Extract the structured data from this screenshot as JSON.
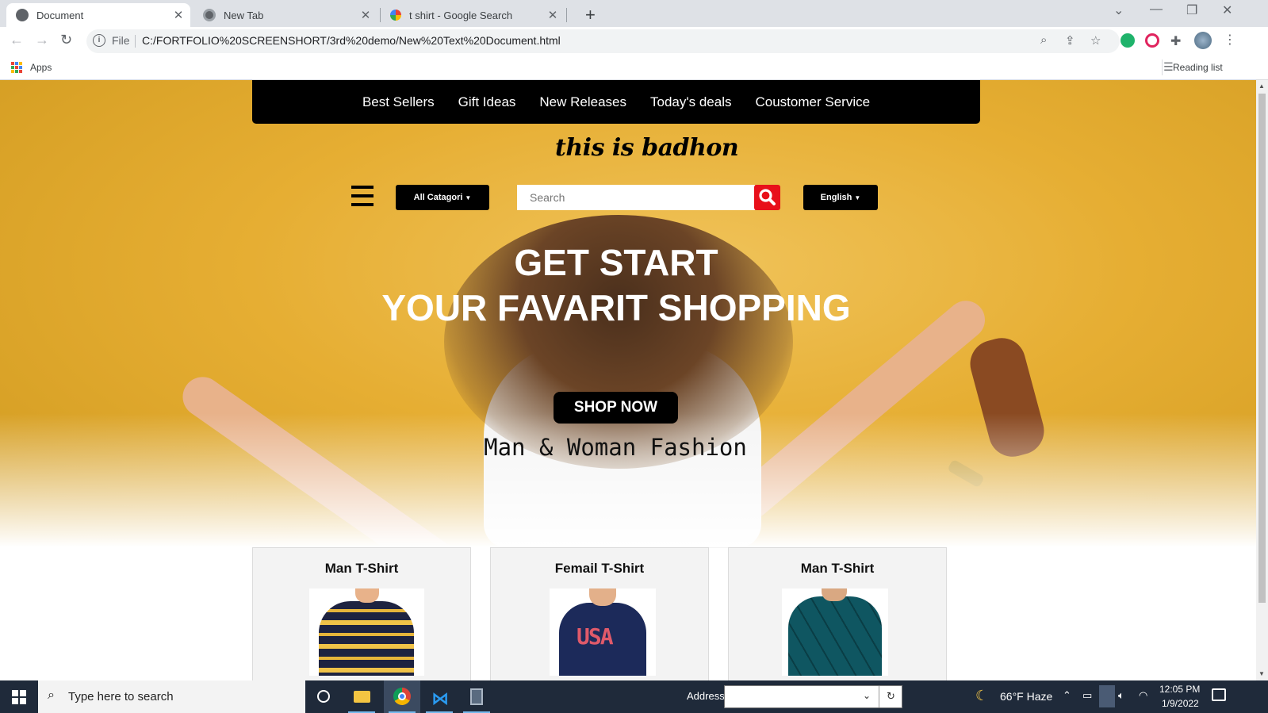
{
  "browser": {
    "tabs": [
      {
        "title": "Document",
        "active": true
      },
      {
        "title": "New Tab",
        "active": false
      },
      {
        "title": "t shirt - Google Search",
        "active": false
      }
    ],
    "new_tab_symbol": "+",
    "close_symbol": "✕",
    "omnibox": {
      "scheme_label": "File",
      "url": "C:/FORTFOLIO%20SCREENSHORT/3rd%20demo/New%20Text%20Document.html"
    },
    "bookmarks": {
      "apps_label": "Apps",
      "reading_list_label": "Reading list"
    }
  },
  "page": {
    "nav_links": [
      "Best Sellers",
      "Gift Ideas",
      "New Releases",
      "Today's deals",
      "Coustomer Service"
    ],
    "brand": "this is badhon",
    "category_dropdown": "All Catagori",
    "search_placeholder": "Search",
    "language_dropdown": "English",
    "headline_line1": "GET START",
    "headline_line2": "YOUR FAVARIT SHOPPING",
    "shop_button": "SHOP NOW",
    "tagline": "Man & Woman Fashion",
    "cards": [
      {
        "title": "Man T-Shirt"
      },
      {
        "title": "Femail T-Shirt"
      },
      {
        "title": "Man T-Shirt"
      }
    ],
    "accent_color": "#e8101a"
  },
  "taskbar": {
    "search_placeholder": "Type here to search",
    "address_label": "Address",
    "weather": "66°F  Haze",
    "time": "12:05 PM",
    "date": "1/9/2022"
  }
}
